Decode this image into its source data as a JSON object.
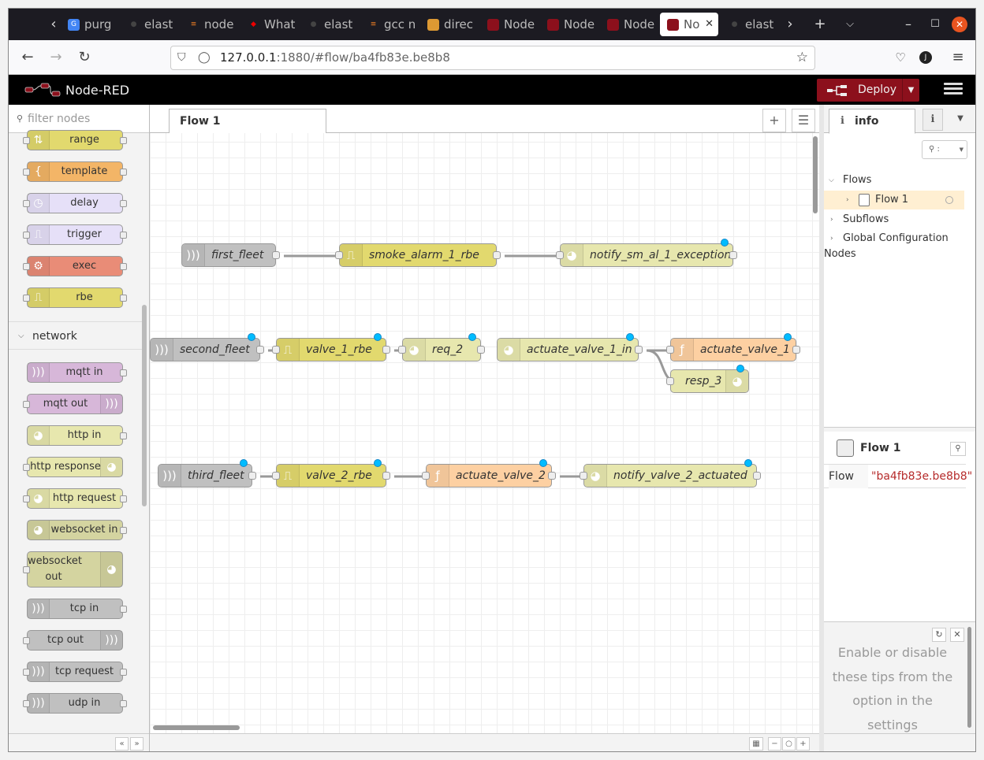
{
  "browser": {
    "tabs": [
      {
        "label": "purg",
        "icon": "G"
      },
      {
        "label": "elast",
        "icon": "gh"
      },
      {
        "label": "node",
        "icon": "so"
      },
      {
        "label": "What",
        "icon": "rh"
      },
      {
        "label": "elast",
        "icon": "gh"
      },
      {
        "label": "gcc n",
        "icon": "so"
      },
      {
        "label": "direc",
        "icon": "ask"
      },
      {
        "label": "Node",
        "icon": "nr"
      },
      {
        "label": "Node",
        "icon": "nr"
      },
      {
        "label": "Node",
        "icon": "nr"
      },
      {
        "label": "No",
        "icon": "nr",
        "active": true
      },
      {
        "label": "elast",
        "icon": "gh"
      }
    ],
    "url_host": "127.0.0.1",
    "url_rest": ":1880/#flow/ba4fb83e.be8b8",
    "profile_initial": "J"
  },
  "header": {
    "title": "Node-RED",
    "deploy_label": "Deploy"
  },
  "palette": {
    "search_placeholder": "filter nodes",
    "nodes_function": [
      {
        "label": "range",
        "color": "#e2d96e",
        "icon": "range-icon"
      },
      {
        "label": "template",
        "color": "#f3b567",
        "icon": "template-icon"
      },
      {
        "label": "delay",
        "color": "#e6e0f8",
        "icon": "clock-icon"
      },
      {
        "label": "trigger",
        "color": "#e6e0f8",
        "icon": "trigger-icon"
      },
      {
        "label": "exec",
        "color": "#e98c77",
        "icon": "cog-icon"
      },
      {
        "label": "rbe",
        "color": "#e2d96e",
        "icon": "rbe-icon"
      }
    ],
    "category_network": "network",
    "nodes_network": [
      {
        "label": "mqtt in",
        "color": "#d7b7d9"
      },
      {
        "label": "mqtt out",
        "color": "#d7b7d9"
      },
      {
        "label": "http in",
        "color": "#e7e7ae"
      },
      {
        "label": "http response",
        "color": "#e7e7ae"
      },
      {
        "label": "http request",
        "color": "#e7e7ae"
      },
      {
        "label": "websocket in",
        "color": "#d4d4a0"
      },
      {
        "label": "websocket out",
        "color": "#d4d4a0"
      },
      {
        "label": "tcp in",
        "color": "#c0c0c0"
      },
      {
        "label": "tcp out",
        "color": "#c0c0c0"
      },
      {
        "label": "tcp request",
        "color": "#c0c0c0"
      },
      {
        "label": "udp in",
        "color": "#c0c0c0"
      }
    ]
  },
  "workspace": {
    "tab_label": "Flow 1",
    "nodes": [
      {
        "label": "first_fleet",
        "color": "#c0c0c0",
        "icon": "bridge-icon"
      },
      {
        "label": "smoke_alarm_1_rbe",
        "color": "#e2d96e",
        "icon": "rbe-icon"
      },
      {
        "label": "notify_sm_al_1_exception",
        "color": "#e7e7ae",
        "icon": "globe-icon"
      },
      {
        "label": "second_fleet",
        "color": "#c0c0c0",
        "icon": "bridge-icon"
      },
      {
        "label": "valve_1_rbe",
        "color": "#e2d96e",
        "icon": "rbe-icon"
      },
      {
        "label": "req_2",
        "color": "#e7e7ae",
        "icon": "globe-icon"
      },
      {
        "label": "actuate_valve_1_in",
        "color": "#e7e7ae",
        "icon": "globe-icon"
      },
      {
        "label": "actuate_valve_1",
        "color": "#fdd0a2",
        "icon": "function-icon"
      },
      {
        "label": "resp_3",
        "color": "#e7e7ae",
        "icon": "globe-icon"
      },
      {
        "label": "third_fleet",
        "color": "#c0c0c0",
        "icon": "bridge-icon"
      },
      {
        "label": "valve_2_rbe",
        "color": "#e2d96e",
        "icon": "rbe-icon"
      },
      {
        "label": "actuate_valve_2",
        "color": "#fdd0a2",
        "icon": "function-icon"
      },
      {
        "label": "notify_valve_2_actuated",
        "color": "#e7e7ae",
        "icon": "globe-icon"
      }
    ]
  },
  "sidebar": {
    "tab_label": "info",
    "search_placeholder": "⚲ :",
    "tree": {
      "flows": "Flows",
      "flow1": "Flow 1",
      "subflows": "Subflows",
      "global_config": "Global Configuration Nodes"
    },
    "info_title": "Flow 1",
    "prop_key": "Flow",
    "prop_value": "\"ba4fb83e.be8b8\"",
    "tip": "Enable or disable these tips from the option in the settings"
  }
}
